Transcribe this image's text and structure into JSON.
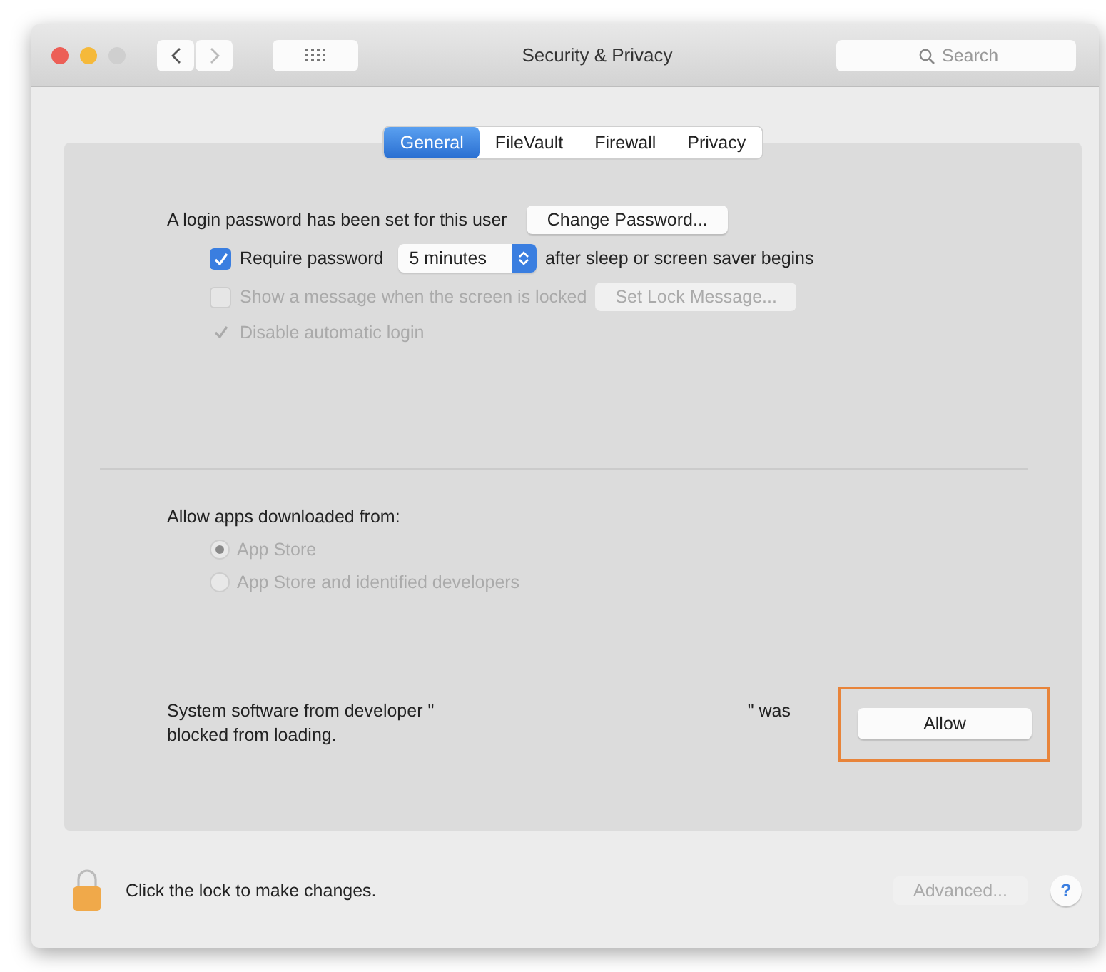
{
  "window": {
    "title": "Security & Privacy",
    "traffic_lights": [
      {
        "color": "#ec5f57"
      },
      {
        "color": "#f5b93a"
      },
      {
        "color": "#cfcfcf"
      }
    ],
    "nav": [
      {
        "kind": "back",
        "disabled": false
      },
      {
        "kind": "forward",
        "disabled": true
      }
    ],
    "search": {
      "placeholder": "Search"
    }
  },
  "tabs": [
    {
      "label": "General",
      "selected": true
    },
    {
      "label": "FileVault",
      "selected": false
    },
    {
      "label": "Firewall",
      "selected": false
    },
    {
      "label": "Privacy",
      "selected": false
    }
  ],
  "login": {
    "text": "A login password has been set for this user",
    "button": "Change Password..."
  },
  "options": [
    {
      "kind": "require",
      "label": "Require password",
      "checked": true,
      "disabled": false,
      "select": "5 minutes",
      "after": "after sleep or screen saver begins"
    },
    {
      "kind": "message",
      "label": "Show a message when the screen is locked",
      "checked": false,
      "disabled": true,
      "button": "Set Lock Message..."
    },
    {
      "kind": "tick",
      "label": "Disable automatic login",
      "checked": true,
      "disabled": true
    }
  ],
  "allow_apps": {
    "heading": "Allow apps downloaded from:",
    "radios": [
      {
        "label": "App Store",
        "selected": true,
        "disabled": true
      },
      {
        "label": "App Store and identified developers",
        "selected": false,
        "disabled": true
      }
    ]
  },
  "blocked": {
    "before": "System software from developer \"",
    "after": "\" was",
    "second_line": "blocked from loading.",
    "button": "Allow",
    "highlighted": true
  },
  "footer": {
    "lock_text": "Click the lock to make changes.",
    "advanced": "Advanced...",
    "advanced_disabled": true,
    "help": "?"
  }
}
